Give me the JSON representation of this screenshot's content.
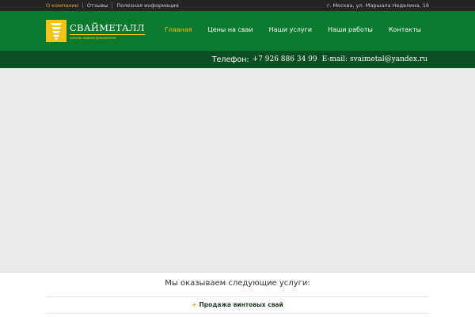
{
  "topbar": {
    "links": [
      {
        "label": "О компании",
        "active": true
      },
      {
        "label": "Отзывы",
        "active": false
      },
      {
        "label": "Полезная информация",
        "active": false
      }
    ],
    "address": "г. Москва, ул. Маршала Неделина, 16"
  },
  "logo": {
    "title": "СВАЙМЕТАЛЛ",
    "subtitle": "монтаж свайных фундаментов",
    "icon": "screw-pile-icon",
    "color": "#f2c318"
  },
  "nav": {
    "items": [
      {
        "label": "Главная",
        "active": true
      },
      {
        "label": "Цены на сваи",
        "active": false
      },
      {
        "label": "Наши услуги",
        "active": false
      },
      {
        "label": "Наши работы",
        "active": false
      },
      {
        "label": "Контакты",
        "active": false
      }
    ]
  },
  "contact": {
    "phone_label": "Телефон:",
    "phone": "+7 926 886 34 99",
    "email": "E-mail: svaimetal@yandex.ru"
  },
  "services": {
    "heading": "Мы оказываем следующие услуги:",
    "items": [
      {
        "label": "Продажа винтовых свай",
        "icon": "plus-icon"
      }
    ]
  },
  "colors": {
    "header_green": "#0b7a2e",
    "contact_bar_green": "#0c4f22",
    "accent_yellow": "#f2c318",
    "topbar_dark": "#242424"
  }
}
